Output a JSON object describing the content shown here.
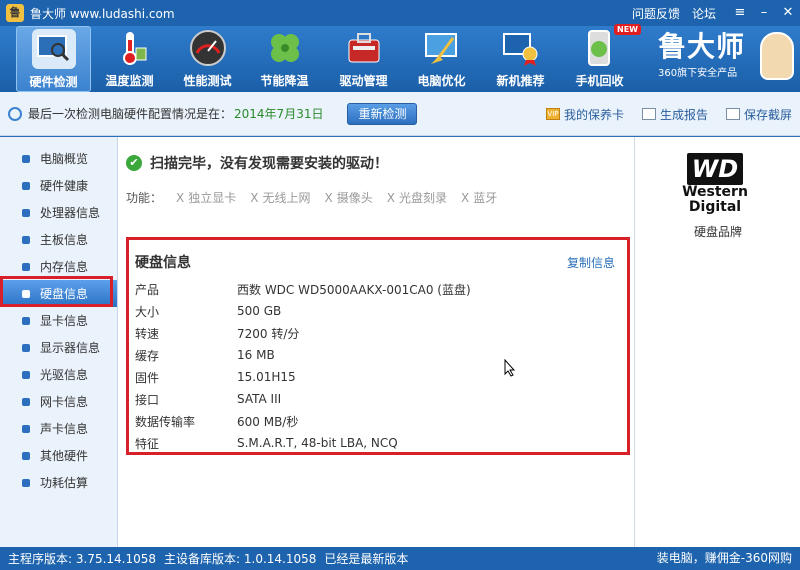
{
  "titlebar": {
    "title": "鲁大师 www.ludashi.com",
    "feedback": "问题反馈",
    "forum": "论坛"
  },
  "nav": {
    "items": [
      {
        "label": "硬件检测",
        "icon": "monitor-search-icon"
      },
      {
        "label": "温度监测",
        "icon": "thermometer-icon"
      },
      {
        "label": "性能测试",
        "icon": "speedometer-icon"
      },
      {
        "label": "节能降温",
        "icon": "clover-icon"
      },
      {
        "label": "驱动管理",
        "icon": "toolbox-icon"
      },
      {
        "label": "电脑优化",
        "icon": "broom-icon"
      },
      {
        "label": "新机推荐",
        "icon": "pc-award-icon"
      },
      {
        "label": "手机回收",
        "icon": "phone-recycle-icon"
      }
    ],
    "new_badge": "NEW",
    "brand_name": "鲁大师",
    "brand_sub": "360旗下安全产品"
  },
  "infobar": {
    "text": "最后一次检测电脑硬件配置情况是在：",
    "date": "2014年7月31日",
    "recheck": "重新检测",
    "warranty": "我的保养卡",
    "vip": "VIP",
    "report": "生成报告",
    "screenshot": "保存截屏"
  },
  "sidebar": {
    "items": [
      {
        "label": "电脑概览"
      },
      {
        "label": "硬件健康"
      },
      {
        "label": "处理器信息"
      },
      {
        "label": "主板信息"
      },
      {
        "label": "内存信息"
      },
      {
        "label": "硬盘信息"
      },
      {
        "label": "显卡信息"
      },
      {
        "label": "显示器信息"
      },
      {
        "label": "光驱信息"
      },
      {
        "label": "网卡信息"
      },
      {
        "label": "声卡信息"
      },
      {
        "label": "其他硬件"
      },
      {
        "label": "功耗估算"
      }
    ]
  },
  "main": {
    "scan_msg": "扫描完毕，没有发现需要安装的驱动！",
    "feature_label": "功能：",
    "features": [
      "独立显卡",
      "无线上网",
      "摄像头",
      "光盘刻录",
      "蓝牙"
    ],
    "feature_mark": "X",
    "disk_title": "硬盘信息",
    "copy": "复制信息",
    "rows": [
      {
        "k": "产品",
        "v": "西数 WDC WD5000AAKX-001CA0 (蓝盘)"
      },
      {
        "k": "大小",
        "v": "500 GB"
      },
      {
        "k": "转速",
        "v": "7200 转/分"
      },
      {
        "k": "缓存",
        "v": "16 MB"
      },
      {
        "k": "固件",
        "v": "15.01H15"
      },
      {
        "k": "接口",
        "v": "SATA III"
      },
      {
        "k": "数据传输率",
        "v": "600 MB/秒"
      },
      {
        "k": "特征",
        "v": "S.M.A.R.T,  48-bit LBA,  NCQ"
      }
    ]
  },
  "rpanel": {
    "logo": "WD",
    "brand_line1": "Western",
    "brand_line2": "Digital",
    "label": "硬盘品牌"
  },
  "statusbar": {
    "main_version": "主程序版本: 3.75.14.1058",
    "db_version": "主设备库版本: 1.0.14.1058",
    "latest": "已经是最新版本",
    "promo": "装电脑，赚佣金-360网购"
  },
  "colors": {
    "titlebar": "#1d63ad",
    "highlight_red": "#d8202a",
    "date_green": "#2a8a2a"
  }
}
